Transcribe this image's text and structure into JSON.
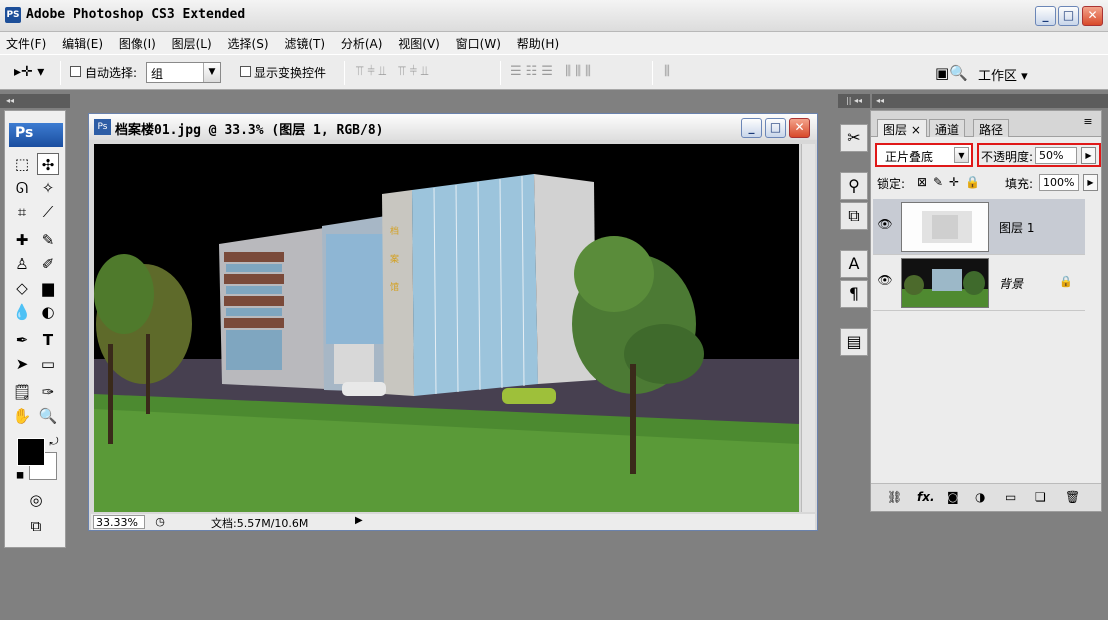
{
  "app": {
    "title": "Adobe Photoshop CS3 Extended",
    "logo": "PS"
  },
  "window_controls": {
    "minimize": "_",
    "maximize": "□",
    "close": "✕"
  },
  "menu": {
    "items": [
      "文件(F)",
      "编辑(E)",
      "图像(I)",
      "图层(L)",
      "选择(S)",
      "滤镜(T)",
      "分析(A)",
      "视图(V)",
      "窗口(W)",
      "帮助(H)"
    ]
  },
  "options_bar": {
    "tool_icon": "move-tool-icon",
    "auto_select_label": "自动选择:",
    "auto_select_value": "组",
    "show_transform_label": "显示变换控件",
    "workspace_label": "工作区 ▾"
  },
  "toolbox": {
    "badge": "Ps",
    "tools": [
      "rectangular-marquee-icon",
      "move-icon",
      "lasso-icon",
      "magic-wand-icon",
      "crop-icon",
      "slice-icon",
      "healing-brush-icon",
      "brush-icon",
      "clone-stamp-icon",
      "history-brush-icon",
      "eraser-icon",
      "gradient-icon",
      "blur-icon",
      "dodge-icon",
      "pen-icon",
      "type-icon",
      "path-selection-icon",
      "shape-icon",
      "notes-icon",
      "eyedropper-icon",
      "hand-icon",
      "zoom-icon"
    ]
  },
  "document": {
    "title": "档案楼01.jpg @ 33.3% (图层 1, RGB/8)",
    "zoom": "33.33%",
    "doc_info": "文档:5.57M/10.6M"
  },
  "layers_panel": {
    "tabs": [
      "图层 ×",
      "通道",
      "路径"
    ],
    "blend_mode": "正片叠底",
    "opacity_label": "不透明度:",
    "opacity_value": "50%",
    "lock_label": "锁定:",
    "fill_label": "填充:",
    "fill_value": "100%",
    "layers": [
      {
        "name": "图层 1",
        "visible": true,
        "selected": true,
        "locked": false
      },
      {
        "name": "背景",
        "visible": true,
        "selected": false,
        "locked": true
      }
    ],
    "bottom_icons": [
      "link-icon",
      "fx-icon",
      "mask-icon",
      "adjustment-icon",
      "group-icon",
      "new-layer-icon",
      "trash-icon"
    ]
  },
  "colors": {
    "highlight_border": "#e01818",
    "selected_layer": "#c7cbd3",
    "ps_blue": "#1d4f99"
  }
}
